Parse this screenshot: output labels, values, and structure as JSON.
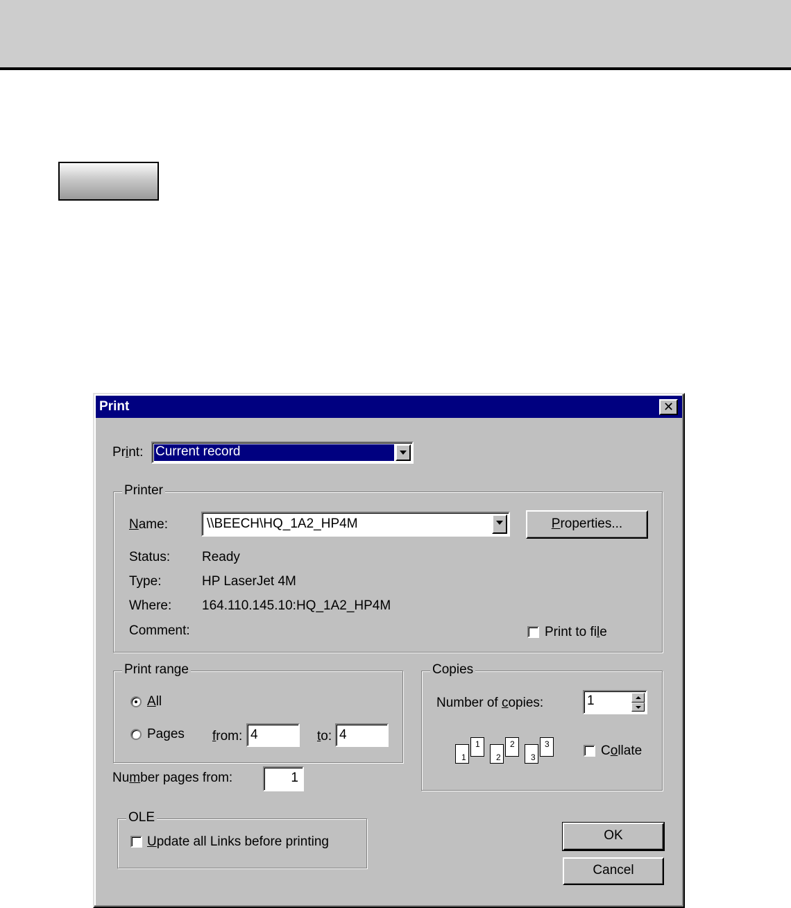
{
  "dialog": {
    "title": "Print",
    "close_glyph": "✕",
    "print_label_prefix": "Pr",
    "print_label_underlined": "i",
    "print_label_suffix": "nt:",
    "print_select_value": "Current record",
    "printer_group": {
      "label": "Printer",
      "name_label_underlined": "N",
      "name_label_rest": "ame:",
      "name_value": "\\\\BEECH\\HQ_1A2_HP4M",
      "properties_underlined": "P",
      "properties_rest": "roperties...",
      "status_label": "Status:",
      "status_value": "Ready",
      "type_label": "Type:",
      "type_value": "HP LaserJet 4M",
      "where_label": "Where:",
      "where_value": "164.110.145.10:HQ_1A2_HP4M",
      "comment_label": "Comment:",
      "print_to_file_prefix": "Print to fi",
      "print_to_file_underlined": "l",
      "print_to_file_suffix": "e",
      "print_to_file_checked": false
    },
    "range_group": {
      "label": "Print range",
      "all_underlined": "A",
      "all_rest": "ll",
      "all_selected": true,
      "pages_prefix": "Pa",
      "pages_underlined": "g",
      "pages_suffix": "es",
      "from_underlined": "f",
      "from_rest": "rom:",
      "from_value": "4",
      "to_underlined": "t",
      "to_rest": "o:",
      "to_value": "4"
    },
    "number_pages_prefix": "Nu",
    "number_pages_underlined": "m",
    "number_pages_suffix": "ber pages from:",
    "number_pages_value": "1",
    "copies_group": {
      "label": "Copies",
      "num_copies_prefix": "Number of ",
      "num_copies_underlined": "c",
      "num_copies_suffix": "opies:",
      "num_copies_value": "1",
      "collate_prefix": "C",
      "collate_underlined": "o",
      "collate_suffix": "llate",
      "collate_checked": false,
      "collate_pages": [
        "1",
        "1",
        "2",
        "2",
        "3",
        "3"
      ]
    },
    "ole_group": {
      "label": "OLE",
      "update_underlined": "U",
      "update_rest": "pdate all Links before printing",
      "update_checked": false
    },
    "ok_label": "OK",
    "cancel_label": "Cancel"
  }
}
